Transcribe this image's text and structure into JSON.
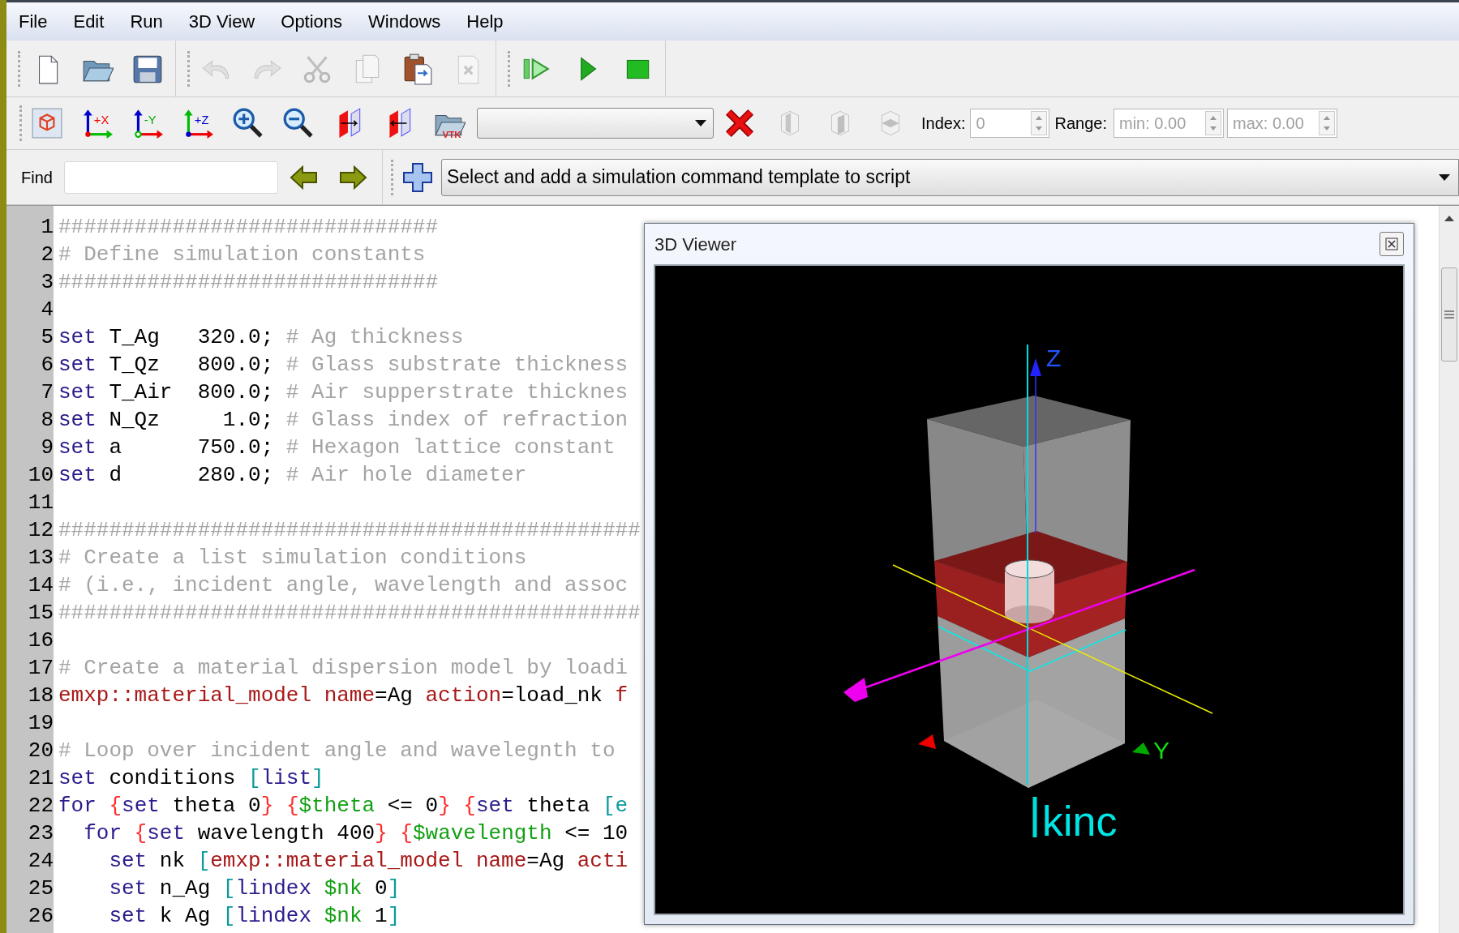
{
  "menu": [
    "File",
    "Edit",
    "Run",
    "3D View",
    "Options",
    "Windows",
    "Help"
  ],
  "main_toolbar": {
    "groups": [
      {
        "buttons": [
          {
            "kind": "new",
            "disabled": false
          },
          {
            "kind": "open",
            "disabled": false
          },
          {
            "kind": "save",
            "disabled": false
          }
        ]
      },
      {
        "buttons": [
          {
            "kind": "undo",
            "disabled": true
          },
          {
            "kind": "redo",
            "disabled": true
          },
          {
            "kind": "cut",
            "disabled": true
          },
          {
            "kind": "copy",
            "disabled": true
          },
          {
            "kind": "paste",
            "disabled": false
          },
          {
            "kind": "delete",
            "disabled": true
          }
        ]
      },
      {
        "buttons": [
          {
            "kind": "step",
            "disabled": false
          },
          {
            "kind": "run",
            "disabled": false
          },
          {
            "kind": "stop",
            "disabled": false
          }
        ]
      }
    ]
  },
  "view_toolbar": {
    "buttons": [
      {
        "kind": "fit"
      },
      {
        "kind": "axis_x",
        "label": "+X"
      },
      {
        "kind": "axis_y",
        "label": "-Y"
      },
      {
        "kind": "axis_z",
        "label": "+Z"
      },
      {
        "kind": "zoom_in"
      },
      {
        "kind": "zoom_out"
      },
      {
        "kind": "clip_forward"
      },
      {
        "kind": "clip_back"
      },
      {
        "kind": "vtk",
        "label": "VTK"
      }
    ],
    "tools": [
      {
        "kind": "remove",
        "disabled": false
      },
      {
        "kind": "slice_x",
        "disabled": true
      },
      {
        "kind": "slice_y",
        "disabled": true
      },
      {
        "kind": "slice_z",
        "disabled": true
      }
    ],
    "index": {
      "label": "Index:",
      "value": "0",
      "disabled": true
    },
    "range": {
      "label": "Range:",
      "min": "min: 0.00",
      "max": "max: 0.00",
      "disabled": true
    }
  },
  "find_bar": {
    "label": "Find",
    "template_selector": "Select and add a simulation command template to script"
  },
  "editor": {
    "lines": [
      {
        "number": "1",
        "tokens": [
          {
            "kind": "comment",
            "text": "##############################"
          }
        ]
      },
      {
        "number": "2",
        "tokens": [
          {
            "kind": "comment",
            "text": "# Define simulation constants"
          }
        ]
      },
      {
        "number": "3",
        "tokens": [
          {
            "kind": "comment",
            "text": "##############################"
          }
        ]
      },
      {
        "number": "4"
      },
      {
        "number": "5",
        "tokens": [
          {
            "kind": "keyword",
            "text": "set"
          },
          {
            "kind": "plain",
            "text": " T_Ag   320.0; "
          },
          {
            "kind": "comment",
            "text": "# Ag thickness"
          }
        ]
      },
      {
        "number": "6",
        "tokens": [
          {
            "kind": "keyword",
            "text": "set"
          },
          {
            "kind": "plain",
            "text": " T_Qz   800.0; "
          },
          {
            "kind": "comment",
            "text": "# Glass substrate thickness"
          }
        ]
      },
      {
        "number": "7",
        "tokens": [
          {
            "kind": "keyword",
            "text": "set"
          },
          {
            "kind": "plain",
            "text": " T_Air  800.0; "
          },
          {
            "kind": "comment",
            "text": "# Air supperstrate thicknes"
          }
        ]
      },
      {
        "number": "8",
        "tokens": [
          {
            "kind": "keyword",
            "text": "set"
          },
          {
            "kind": "plain",
            "text": " N_Qz     1.0; "
          },
          {
            "kind": "comment",
            "text": "# Glass index of refraction"
          }
        ]
      },
      {
        "number": "9",
        "tokens": [
          {
            "kind": "keyword",
            "text": "set"
          },
          {
            "kind": "plain",
            "text": " a      750.0; "
          },
          {
            "kind": "comment",
            "text": "# Hexagon lattice constant"
          }
        ]
      },
      {
        "number": "10",
        "tokens": [
          {
            "kind": "keyword",
            "text": "set"
          },
          {
            "kind": "plain",
            "text": " d      280.0; "
          },
          {
            "kind": "comment",
            "text": "# Air hole diameter"
          }
        ]
      },
      {
        "number": "11"
      },
      {
        "number": "12",
        "tokens": [
          {
            "kind": "comment",
            "text": "##############################################"
          }
        ]
      },
      {
        "number": "13",
        "tokens": [
          {
            "kind": "comment",
            "text": "# Create a list simulation conditions"
          }
        ]
      },
      {
        "number": "14",
        "tokens": [
          {
            "kind": "comment",
            "text": "# (i.e., incident angle, wavelength and assoc"
          }
        ]
      },
      {
        "number": "15",
        "tokens": [
          {
            "kind": "comment",
            "text": "##############################################"
          }
        ]
      },
      {
        "number": "16"
      },
      {
        "number": "17",
        "tokens": [
          {
            "kind": "comment",
            "text": "# Create a material dispersion model by loadi"
          }
        ]
      },
      {
        "number": "18",
        "tokens": [
          {
            "kind": "command",
            "text": "emxp::material_model"
          },
          {
            "kind": "command",
            "text": " name"
          },
          {
            "kind": "plain",
            "text": "=Ag "
          },
          {
            "kind": "command",
            "text": "action"
          },
          {
            "kind": "plain",
            "text": "=load_nk "
          },
          {
            "kind": "command",
            "text": "f"
          }
        ]
      },
      {
        "number": "19"
      },
      {
        "number": "20",
        "tokens": [
          {
            "kind": "comment",
            "text": "# Loop over incident angle and wavelegnth to"
          }
        ]
      },
      {
        "number": "21",
        "tokens": [
          {
            "kind": "keyword",
            "text": "set"
          },
          {
            "kind": "plain",
            "text": " conditions "
          },
          {
            "kind": "bracket",
            "text": "["
          },
          {
            "kind": "keyword",
            "text": "list"
          },
          {
            "kind": "bracket",
            "text": "]"
          }
        ]
      },
      {
        "number": "22",
        "tokens": [
          {
            "kind": "keyword",
            "text": "for"
          },
          {
            "kind": "brace",
            "text": " {"
          },
          {
            "kind": "keyword",
            "text": "set"
          },
          {
            "kind": "plain",
            "text": " theta 0"
          },
          {
            "kind": "brace",
            "text": "}"
          },
          {
            "kind": "brace",
            "text": " {"
          },
          {
            "kind": "variable",
            "text": "$theta"
          },
          {
            "kind": "plain",
            "text": " <= 0"
          },
          {
            "kind": "brace",
            "text": "}"
          },
          {
            "kind": "brace",
            "text": " {"
          },
          {
            "kind": "keyword",
            "text": "set"
          },
          {
            "kind": "plain",
            "text": " theta "
          },
          {
            "kind": "bracket",
            "text": "[e"
          }
        ]
      },
      {
        "number": "23",
        "tokens": [
          {
            "kind": "keyword",
            "text": "  for"
          },
          {
            "kind": "brace",
            "text": " {"
          },
          {
            "kind": "keyword",
            "text": "set"
          },
          {
            "kind": "plain",
            "text": " wavelength 400"
          },
          {
            "kind": "brace",
            "text": "}"
          },
          {
            "kind": "brace",
            "text": " {"
          },
          {
            "kind": "variable",
            "text": "$wavelength"
          },
          {
            "kind": "plain",
            "text": " <= 10"
          }
        ]
      },
      {
        "number": "24",
        "tokens": [
          {
            "kind": "keyword",
            "text": "    set"
          },
          {
            "kind": "plain",
            "text": " nk "
          },
          {
            "kind": "bracket",
            "text": "["
          },
          {
            "kind": "command",
            "text": "emxp::material_model"
          },
          {
            "kind": "command",
            "text": " name"
          },
          {
            "kind": "plain",
            "text": "=Ag "
          },
          {
            "kind": "command",
            "text": "acti"
          }
        ]
      },
      {
        "number": "25",
        "tokens": [
          {
            "kind": "keyword",
            "text": "    set"
          },
          {
            "kind": "plain",
            "text": " n_Ag "
          },
          {
            "kind": "bracket",
            "text": "["
          },
          {
            "kind": "keyword",
            "text": "lindex"
          },
          {
            "kind": "variable",
            "text": " $nk"
          },
          {
            "kind": "plain",
            "text": " 0"
          },
          {
            "kind": "bracket",
            "text": "]"
          }
        ]
      },
      {
        "number": "26",
        "tokens": [
          {
            "kind": "keyword",
            "text": "    set"
          },
          {
            "kind": "plain",
            "text": " k Ag "
          },
          {
            "kind": "bracket",
            "text": "["
          },
          {
            "kind": "keyword",
            "text": "lindex"
          },
          {
            "kind": "variable",
            "text": " $nk"
          },
          {
            "kind": "plain",
            "text": " 1"
          },
          {
            "kind": "bracket",
            "text": "]"
          }
        ]
      }
    ]
  },
  "viewer": {
    "title": "3D Viewer",
    "labels": [
      {
        "kind": "z",
        "text": "Z"
      },
      {
        "kind": "y",
        "text": "Y"
      },
      {
        "kind": "vector",
        "text": "kinc"
      }
    ]
  }
}
